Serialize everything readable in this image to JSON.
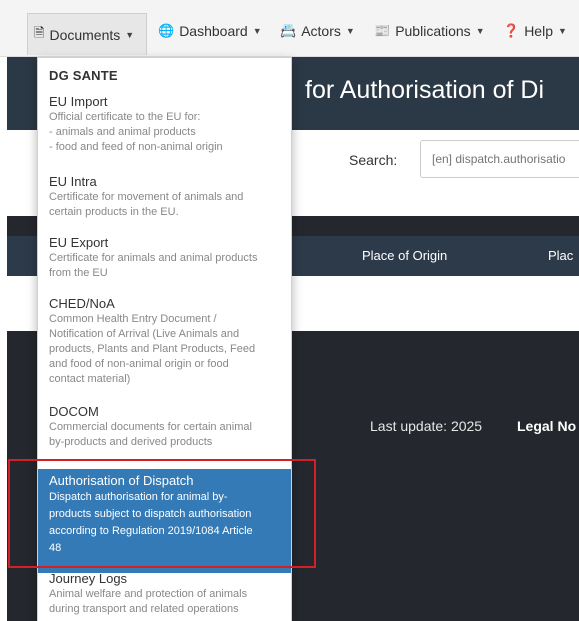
{
  "navbar": {
    "items": [
      {
        "label": "Documents",
        "icon": "document-icon"
      },
      {
        "label": "Dashboard",
        "icon": "globe-icon"
      },
      {
        "label": "Actors",
        "icon": "id-card-icon"
      },
      {
        "label": "Publications",
        "icon": "newspaper-icon"
      },
      {
        "label": "Help",
        "icon": "question-circle-icon"
      }
    ]
  },
  "page": {
    "title": "for Authorisation of Di",
    "search_label": "Search:",
    "search_placeholder": "[en] dispatch.authorisatio",
    "columns": [
      "Place of Origin",
      "Plac"
    ],
    "footer_last_update": "Last update: 2025",
    "footer_legal": "Legal No"
  },
  "dropdown": {
    "header": "DG SANTE",
    "items": [
      {
        "title": "EU Import",
        "desc": [
          "Official certificate to the EU for:",
          "- animals and animal products",
          "- food and feed of non-animal origin"
        ]
      },
      {
        "title": "EU Intra",
        "desc": [
          "Certificate for movement of animals and",
          "certain products in the EU."
        ]
      },
      {
        "title": "EU Export",
        "desc": [
          "Certificate for animals and animal products",
          "from the EU"
        ]
      },
      {
        "title": "CHED/NoA",
        "desc": [
          "Common Health Entry Document /",
          "Notification of Arrival (Live Animals and",
          "products, Plants and Plant Products, Feed",
          "and food of non-animal origin or food",
          "contact material)"
        ]
      },
      {
        "title": "DOCOM",
        "desc": [
          "Commercial documents for certain animal",
          "by-products and derived products"
        ]
      },
      {
        "title": "Authorisation of Dispatch",
        "desc": [
          "Dispatch authorisation for animal by-",
          "products subject to dispatch authorisation",
          "according to Regulation 2019/1084 Article",
          "48"
        ]
      },
      {
        "title": "Journey Logs",
        "desc": [
          "Animal welfare and protection of animals",
          "during transport and related operations"
        ]
      }
    ],
    "active_index": 5
  },
  "colors": {
    "active_bg": "#337ab7",
    "highlight_border": "#d32027",
    "page_dark": "#24272d",
    "table_header": "#2d3a4a"
  }
}
